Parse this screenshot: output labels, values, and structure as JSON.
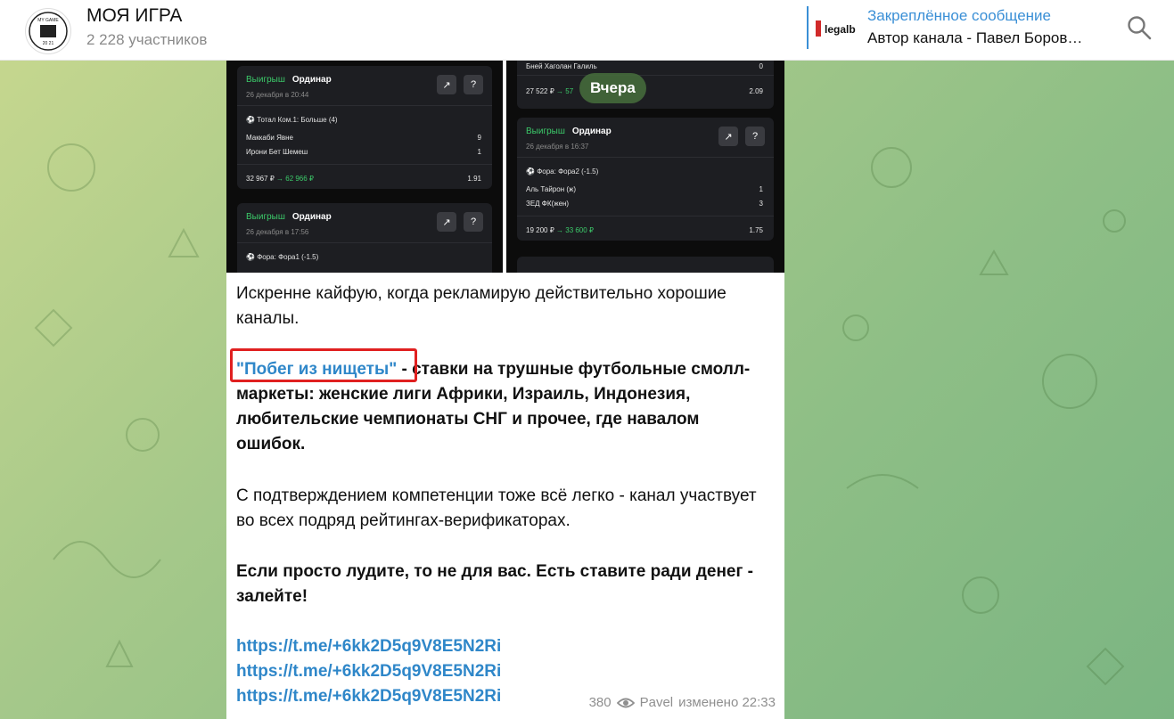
{
  "header": {
    "title": "МОЯ ИГРА",
    "subtitle": "2 228 участников",
    "avatar_text_top": "MY GAME",
    "avatar_text_bottom": "20 21",
    "pinned_label": "Закреплённое сообщение",
    "pinned_text": "Автор канала - Павел Боров…",
    "pinned_thumb_text": "legalb"
  },
  "post": {
    "date_pill": "Вчера",
    "screens": {
      "left": {
        "card1": {
          "status": "Выигрыш",
          "type": "Ординар",
          "date": "26 декабря в 20:44",
          "market": "Тотал Ком.1: Больше (4)",
          "team1": "Маккаби Явне",
          "score1": "9",
          "team2": "Ирони Бет Шемеш",
          "score2": "1",
          "stake": "32 967 ₽",
          "payout": "→ 62 966 ₽",
          "odds": "1.91"
        },
        "card2": {
          "status": "Выигрыш",
          "type": "Ординар",
          "date": "26 декабря в 17:56",
          "market": "Фора: Фора1 (-1.5)"
        }
      },
      "right": {
        "card0": {
          "team": "Бней Хаголан Галиль",
          "score": "0",
          "stake": "27 522 ₽",
          "payout": "→ 57",
          "odds": "2.09"
        },
        "card1": {
          "status": "Выигрыш",
          "type": "Ординар",
          "date": "26 декабря в 16:37",
          "market": "Фора: Фора2 (-1.5)",
          "team1": "Аль Тайрон (ж)",
          "score1": "1",
          "team2": "ЗЕД ФК(жен)",
          "score2": "3",
          "stake": "19 200 ₽",
          "payout": "→ 33 600 ₽",
          "odds": "1.75"
        }
      }
    },
    "paragraph1": "Искренне кайфую, когда рекламирую действительно хорошие каналы.",
    "link_name": "\"Побег из нищеты\"",
    "paragraph2_rest": " - ставки на трушные футбольные смолл-маркеты: женские лиги Африки, Израиль, Индонезия, любительские чемпионаты СНГ и прочее, где навалом ошибок.",
    "paragraph3": "С подтверждением компетенции тоже всё легко - канал участвует во всех подряд рейтингах-верификаторах.",
    "paragraph4": "Если просто лудите, то не для вас. Есть ставите ради денег - залейте!",
    "links": [
      "https://t.me/+6kk2D5q9V8E5N2Ri",
      "https://t.me/+6kk2D5q9V8E5N2Ri",
      "https://t.me/+6kk2D5q9V8E5N2Ri"
    ],
    "views": "380",
    "author": "Pavel",
    "edited": "изменено 22:33"
  },
  "colors": {
    "accent": "#3a8fd6",
    "link": "#2f87c9",
    "win_green": "#3ccb6a",
    "highlight_red": "#e02020"
  }
}
